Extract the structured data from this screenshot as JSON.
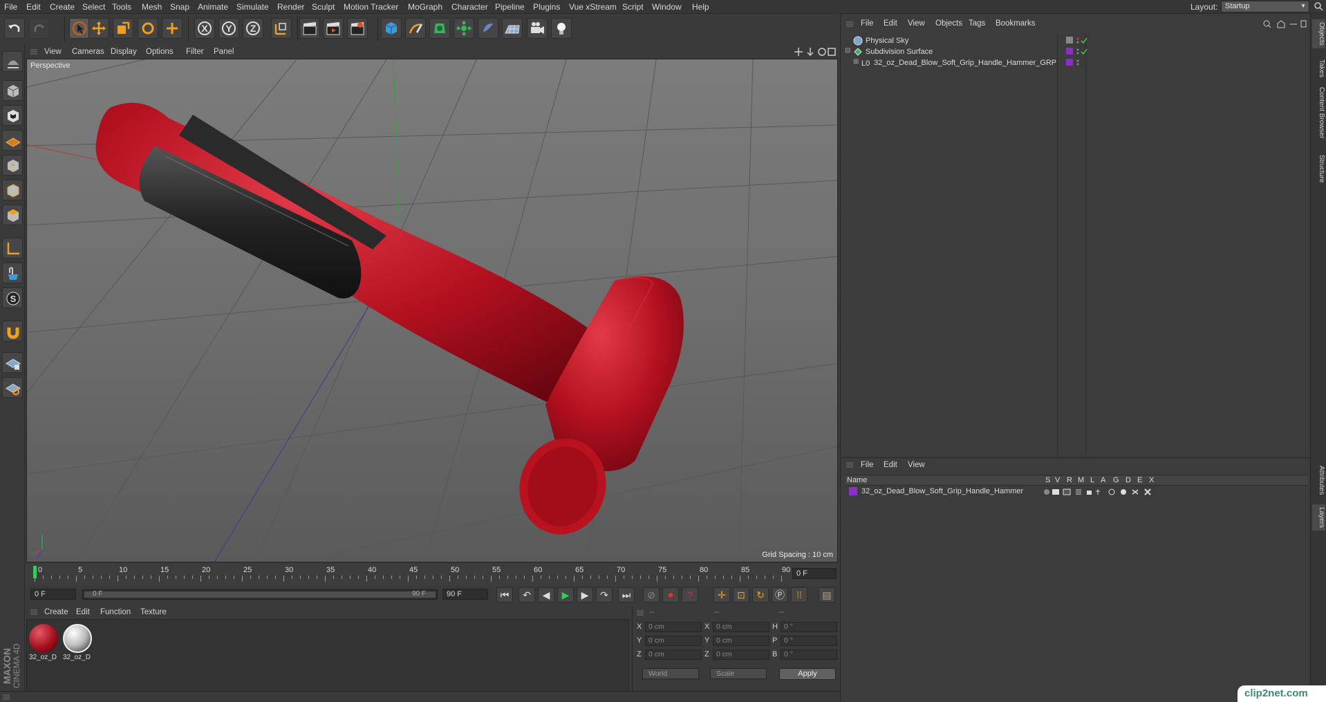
{
  "menubar": {
    "items": [
      "File",
      "Edit",
      "Create",
      "Select",
      "Tools",
      "Mesh",
      "Snap",
      "Animate",
      "Simulate",
      "Render",
      "Sculpt",
      "Motion Tracker",
      "MoGraph",
      "Character",
      "Pipeline",
      "Plugins",
      "Vue xStream",
      "Script",
      "Window",
      "Help"
    ],
    "layout_label": "Layout:",
    "layout_value": "Startup"
  },
  "viewport": {
    "menu": [
      "View",
      "Cameras",
      "Display",
      "Options",
      "Filter",
      "Panel"
    ],
    "label": "Perspective",
    "grid_spacing": "Grid Spacing : 10 cm",
    "model_color": "#b3101f"
  },
  "timeline": {
    "ticks": [
      "0",
      "5",
      "10",
      "15",
      "20",
      "25",
      "30",
      "35",
      "40",
      "45",
      "50",
      "55",
      "60",
      "65",
      "70",
      "75",
      "80",
      "85",
      "90"
    ],
    "current_frame": "0 F",
    "start": "0 F",
    "range_start": "0 F",
    "range_end": "90 F",
    "end": "90 F"
  },
  "materials": {
    "menu": [
      "Create",
      "Edit",
      "Function",
      "Texture"
    ],
    "items": [
      {
        "label": "32_oz_D"
      },
      {
        "label": "32_oz_D"
      }
    ]
  },
  "coords": {
    "header": [
      "--",
      "--",
      "--"
    ],
    "rows": [
      {
        "a": "X",
        "av": "0 cm",
        "b": "X",
        "bv": "0 cm",
        "c": "H",
        "cv": "0 °"
      },
      {
        "a": "Y",
        "av": "0 cm",
        "b": "Y",
        "bv": "0 cm",
        "c": "P",
        "cv": "0 °"
      },
      {
        "a": "Z",
        "av": "0 cm",
        "b": "Z",
        "bv": "0 cm",
        "c": "B",
        "cv": "0 °"
      }
    ],
    "space": "World",
    "mode": "Scale",
    "apply": "Apply"
  },
  "objects": {
    "menu": [
      "File",
      "Edit",
      "View",
      "Objects",
      "Tags",
      "Bookmarks"
    ],
    "items": [
      {
        "name": "Physical Sky"
      },
      {
        "name": "Subdivision Surface"
      },
      {
        "name": "32_oz_Dead_Blow_Soft_Grip_Handle_Hammer_GRP"
      }
    ]
  },
  "layers": {
    "menu": [
      "File",
      "Edit",
      "View"
    ],
    "columns": [
      "Name",
      "S",
      "V",
      "R",
      "M",
      "L",
      "A",
      "G",
      "D",
      "E",
      "X"
    ],
    "row": "32_oz_Dead_Blow_Soft_Grip_Handle_Hammer"
  },
  "right_tabs": [
    "Objects",
    "Takes",
    "Content Browser",
    "Structure",
    "Attributes",
    "Layers"
  ],
  "logo": {
    "line1": "MAXON",
    "line2": "CINEMA 4D"
  },
  "watermark": "clip2net.com"
}
